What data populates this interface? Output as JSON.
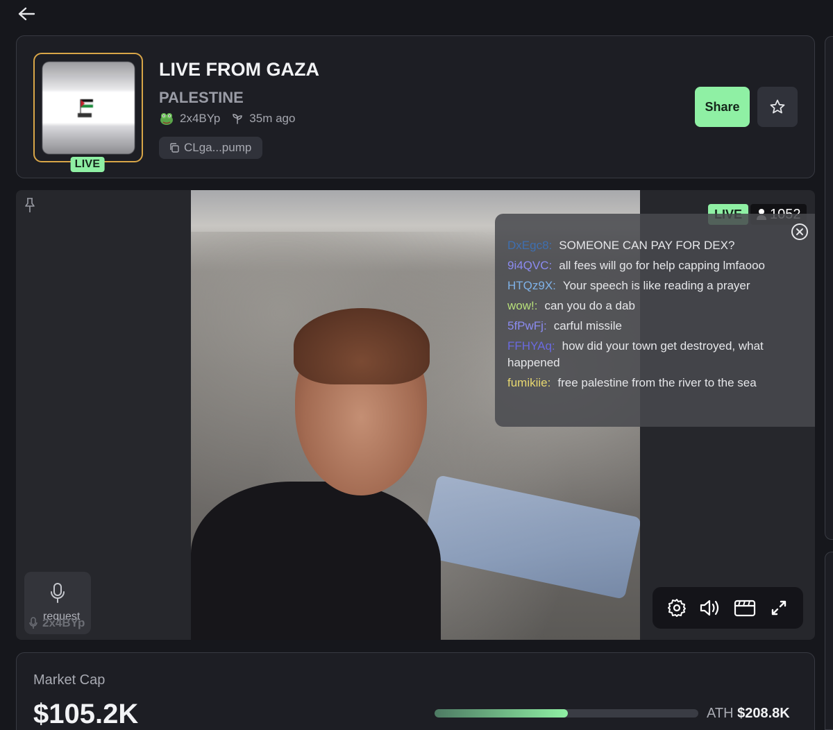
{
  "header": {
    "title": "LIVE FROM GAZA",
    "subtitle": "PALESTINE",
    "creator": "2x4BYp",
    "created_ago": "35m ago",
    "contract": "CLga...pump",
    "live_label": "LIVE",
    "share_label": "Share"
  },
  "stream": {
    "live_label": "LIVE",
    "viewers": "1052",
    "request_label": "request",
    "host": "2x4BYp"
  },
  "chat": [
    {
      "user": "DxEgc8:",
      "text": "SOMEONE CAN PAY FOR DEX?",
      "color": "#3f6fb0"
    },
    {
      "user": "9i4QVC:",
      "text": "all fees will go for help capping lmfaooo",
      "color": "#8b8bf0"
    },
    {
      "user": "HTQz9X:",
      "text": "Your speech is like reading a prayer",
      "color": "#7fb2e8"
    },
    {
      "user": "wow!:",
      "text": "can you do a dab",
      "color": "#b8e07a"
    },
    {
      "user": "5fPwFj:",
      "text": "carful missile",
      "color": "#8b8bf0"
    },
    {
      "user": "FFHYAq:",
      "text": "how did your town get destroyed, what happened",
      "color": "#6a6ae0"
    },
    {
      "user": "fumikiie:",
      "text": "free palestine from the river to the sea",
      "color": "#e8d870"
    }
  ],
  "market": {
    "label": "Market Cap",
    "value": "$105.2K",
    "ath_label": "ATH",
    "ath_value": "$208.8K",
    "progress_fraction": 0.504
  },
  "icons": {
    "back": "arrow-left-icon",
    "creator_avatar": "frog-avatar-icon",
    "time": "sprout-icon",
    "copy": "copy-icon",
    "star": "star-icon",
    "pin": "pin-icon",
    "mic": "mic-icon",
    "user": "user-icon",
    "close": "close-circle-icon",
    "settings": "gear-icon",
    "volume": "volume-icon",
    "clip": "clapperboard-icon",
    "fullscreen": "fullscreen-icon"
  },
  "colors": {
    "accent_green": "#8ff0a4",
    "thumb_border": "#d9a648",
    "background": "#16171c"
  }
}
